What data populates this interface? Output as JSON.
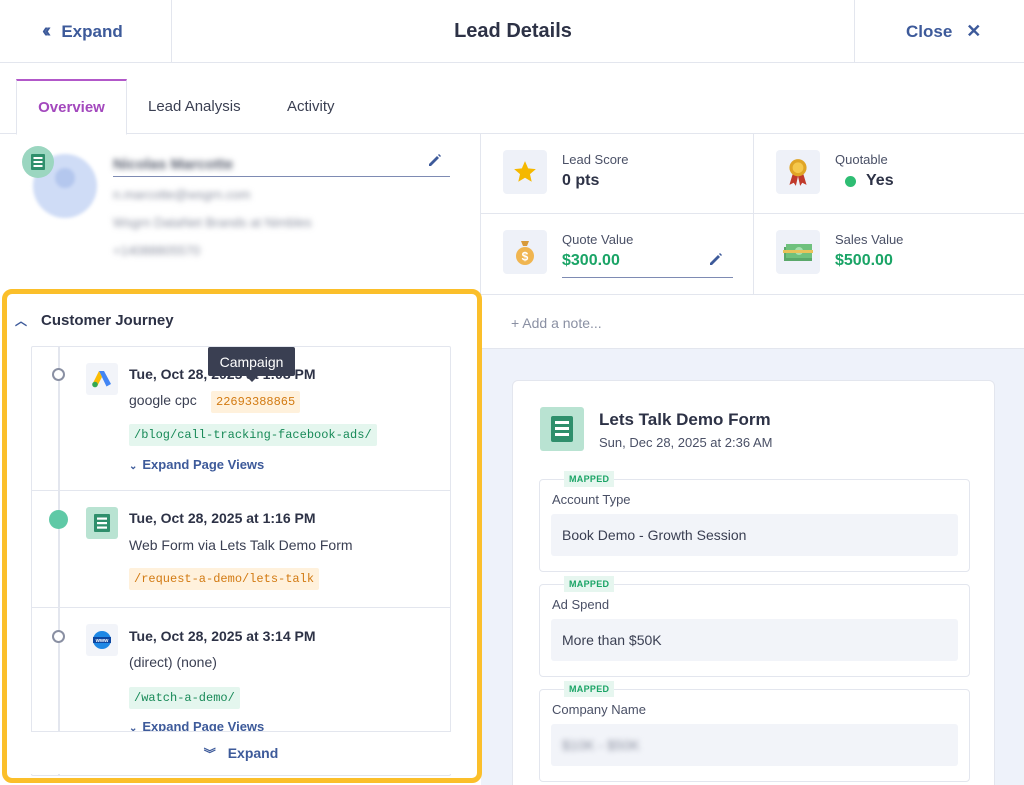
{
  "header": {
    "expand_label": "Expand",
    "title": "Lead Details",
    "close_label": "Close"
  },
  "tabs": [
    {
      "label": "Overview",
      "active": true
    },
    {
      "label": "Lead Analysis",
      "active": false
    },
    {
      "label": "Activity",
      "active": false
    }
  ],
  "profile": {
    "name": "Nicolas Marcotte",
    "email": "n.marcotte@wsgrn.com",
    "title": "Wsgrn DataNet Brands at Nimbles",
    "phone": "+14088805570"
  },
  "stats": {
    "lead_score": {
      "label": "Lead Score",
      "value": "0 pts",
      "icon": "star-icon"
    },
    "quotable": {
      "label": "Quotable",
      "value": "Yes",
      "icon": "award-icon"
    },
    "quote_value": {
      "label": "Quote Value",
      "value": "$300.00",
      "icon": "money-bag-icon"
    },
    "sales_value": {
      "label": "Sales Value",
      "value": "$500.00",
      "icon": "cash-icon"
    }
  },
  "note": {
    "placeholder": "+ Add a note..."
  },
  "form_card": {
    "title": "Lets Talk Demo Form",
    "timestamp": "Sun, Dec 28, 2025 at 2:36 AM",
    "fields": [
      {
        "badge": "MAPPED",
        "label": "Account Type",
        "value": "Book Demo - Growth Session"
      },
      {
        "badge": "MAPPED",
        "label": "Ad Spend",
        "value": "More than $50K"
      },
      {
        "badge": "MAPPED",
        "label": "Company Name",
        "value": "$10K - $50K"
      }
    ]
  },
  "journey": {
    "title": "Customer Journey",
    "tooltip": "Campaign",
    "items": [
      {
        "date": "Tue, Oct 28, 2025 at 1:08 PM",
        "source": "google cpc",
        "campaign": "22693388865",
        "path": "/blog/call-tracking-facebook-ads/",
        "expand": "Expand Page Views",
        "icon": "google-ads-icon"
      },
      {
        "date": "Tue, Oct 28, 2025 at 1:16 PM",
        "source": "Web Form via Lets Talk Demo Form",
        "path": "/request-a-demo/lets-talk",
        "icon": "form-icon"
      },
      {
        "date": "Tue, Oct 28, 2025 at 3:14 PM",
        "source": "(direct) (none)",
        "path": "/watch-a-demo/",
        "expand": "Expand Page Views",
        "icon": "www-globe-icon"
      }
    ],
    "expand_all": "Expand"
  }
}
